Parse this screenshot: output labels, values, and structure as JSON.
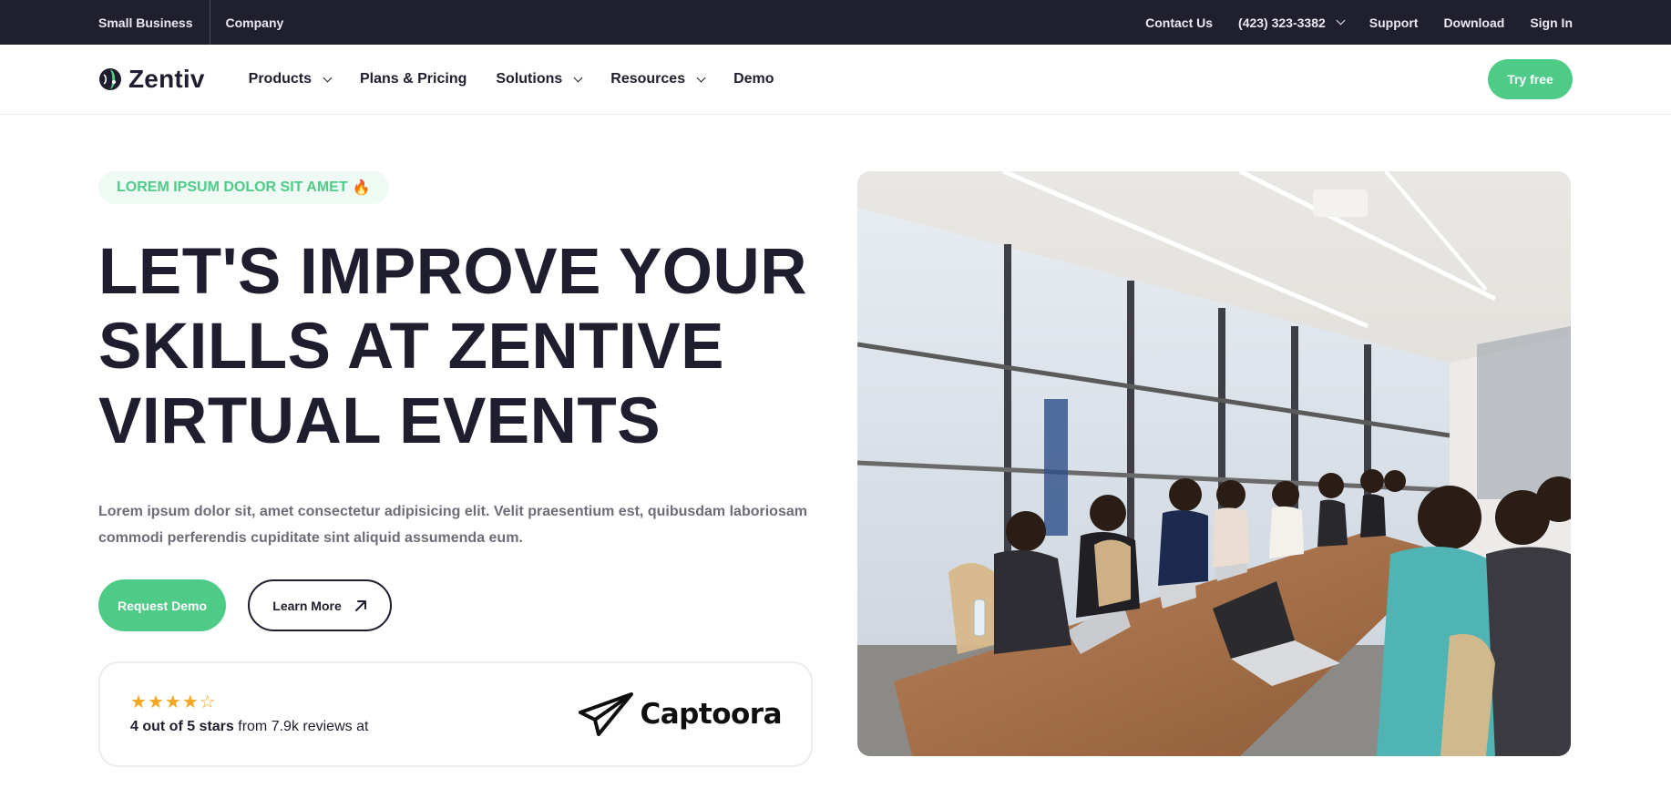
{
  "topbar": {
    "left": [
      "Small Business",
      "Company"
    ],
    "contact": "Contact Us",
    "phone": "(423) 323-3382",
    "support": "Support",
    "download": "Download",
    "signin": "Sign In"
  },
  "nav": {
    "brand": "Zentiv",
    "items": [
      {
        "label": "Products",
        "dropdown": true
      },
      {
        "label": "Plans & Pricing",
        "dropdown": false
      },
      {
        "label": "Solutions",
        "dropdown": true
      },
      {
        "label": "Resources",
        "dropdown": true
      },
      {
        "label": "Demo",
        "dropdown": false
      }
    ],
    "cta": "Try free"
  },
  "hero": {
    "eyebrow": "LOREM IPSUM DOLOR SIT AMET",
    "eyebrow_icon": "🔥",
    "headline_lines": [
      "LET'S IMPROVE YOUR",
      "SKILLS AT ZENTIVE",
      "VIRTUAL EVENTS"
    ],
    "lead": "Lorem ipsum dolor sit, amet consectetur adipisicing elit. Velit praesentium est, quibusdam laboriosam commodi perferendis cupiditate sint aliquid assumenda eum.",
    "primary_cta": "Request Demo",
    "secondary_cta": "Learn More",
    "secondary_cta_icon": "arrow-up-right-icon"
  },
  "review": {
    "rating": 4,
    "max_rating": 5,
    "rating_text": "4 out of 5 stars",
    "rest_text": " from 7.9k reviews at",
    "platform": "Captoora",
    "platform_icon": "paper-plane-icon"
  },
  "colors": {
    "accent": "#4fcb88",
    "dark": "#201f2d",
    "star": "#f5a623"
  }
}
